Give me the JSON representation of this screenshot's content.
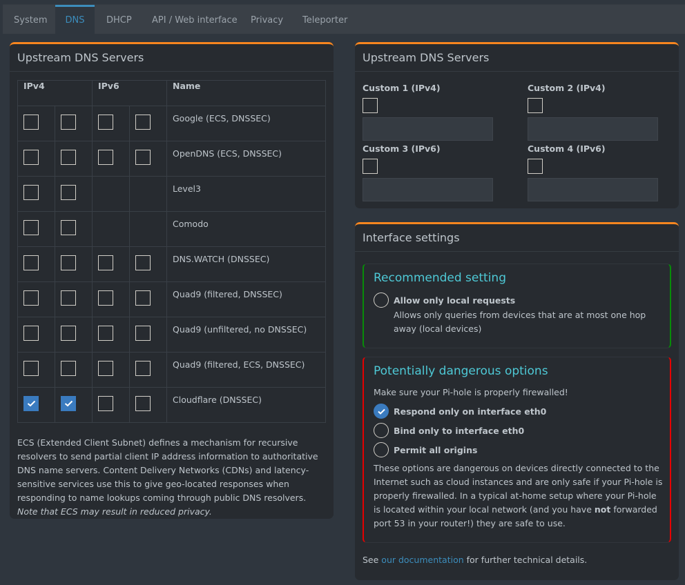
{
  "tabs": [
    {
      "label": "System",
      "active": false
    },
    {
      "label": "DNS",
      "active": true
    },
    {
      "label": "DHCP",
      "active": false
    },
    {
      "label": "API / Web interface",
      "active": false
    },
    {
      "label": "Privacy",
      "active": false
    },
    {
      "label": "Teleporter",
      "active": false
    }
  ],
  "upstream_list": {
    "title": "Upstream DNS Servers",
    "headers": {
      "ipv4": "IPv4",
      "ipv6": "IPv6",
      "name": "Name"
    },
    "rows": [
      {
        "name": "Google (ECS, DNSSEC)",
        "ipv4": [
          false,
          false
        ],
        "ipv6": [
          false,
          false
        ]
      },
      {
        "name": "OpenDNS (ECS, DNSSEC)",
        "ipv4": [
          false,
          false
        ],
        "ipv6": [
          false,
          false
        ]
      },
      {
        "name": "Level3",
        "ipv4": [
          false,
          false
        ],
        "ipv6": null
      },
      {
        "name": "Comodo",
        "ipv4": [
          false,
          false
        ],
        "ipv6": null
      },
      {
        "name": "DNS.WATCH (DNSSEC)",
        "ipv4": [
          false,
          false
        ],
        "ipv6": [
          false,
          false
        ]
      },
      {
        "name": "Quad9 (filtered, DNSSEC)",
        "ipv4": [
          false,
          false
        ],
        "ipv6": [
          false,
          false
        ]
      },
      {
        "name": "Quad9 (unfiltered, no DNSSEC)",
        "ipv4": [
          false,
          false
        ],
        "ipv6": [
          false,
          false
        ]
      },
      {
        "name": "Quad9 (filtered, ECS, DNSSEC)",
        "ipv4": [
          false,
          false
        ],
        "ipv6": [
          false,
          false
        ]
      },
      {
        "name": "Cloudflare (DNSSEC)",
        "ipv4": [
          true,
          true
        ],
        "ipv6": [
          false,
          false
        ]
      }
    ],
    "ecs_note": "ECS (Extended Client Subnet) defines a mechanism for recursive resolvers to send partial client IP address information to authoritative DNS name servers. Content Delivery Networks (CDNs) and latency-sensitive services use this to give geo-located responses when responding to name lookups coming through public DNS resolvers. ",
    "ecs_note_italic": "Note that ECS may result in reduced privacy."
  },
  "custom_upstream": {
    "title": "Upstream DNS Servers",
    "fields": [
      {
        "label": "Custom 1 (IPv4)",
        "checked": false,
        "value": "",
        "placeholder": ""
      },
      {
        "label": "Custom 2 (IPv4)",
        "checked": false,
        "value": "",
        "placeholder": ""
      },
      {
        "label": "Custom 3 (IPv6)",
        "checked": false,
        "value": "",
        "placeholder": ""
      },
      {
        "label": "Custom 4 (IPv6)",
        "checked": false,
        "value": "",
        "placeholder": ""
      }
    ]
  },
  "interface_settings": {
    "title": "Interface settings",
    "recommended": {
      "title": "Recommended setting",
      "option_label": "Allow only local requests",
      "option_checked": false,
      "description": "Allows only queries from devices that are at most one hop away (local devices)"
    },
    "dangerous": {
      "title": "Potentially dangerous options",
      "warning": "Make sure your Pi-hole is properly firewalled!",
      "options": [
        {
          "label": "Respond only on interface eth0",
          "checked": true
        },
        {
          "label": "Bind only to interface eth0",
          "checked": false
        },
        {
          "label": "Permit all origins",
          "checked": false
        }
      ],
      "desc_part1": "These options are dangerous on devices directly connected to the Internet such as cloud instances and are only safe if your Pi-hole is properly firewalled. In a typical at-home setup where your Pi-hole is located within your local network (and you have ",
      "desc_bold": "not",
      "desc_part2": " forwarded port 53 in your router!) they are safe to use."
    },
    "footer_pre": "See ",
    "footer_link": "our documentation",
    "footer_post": " for further technical details."
  },
  "colors": {
    "accent": "#3c8dbc",
    "box_top": "#f8861f",
    "recommended_border": "#078c08",
    "danger_border": "#e50000",
    "subtitle": "#4ec9d6"
  }
}
